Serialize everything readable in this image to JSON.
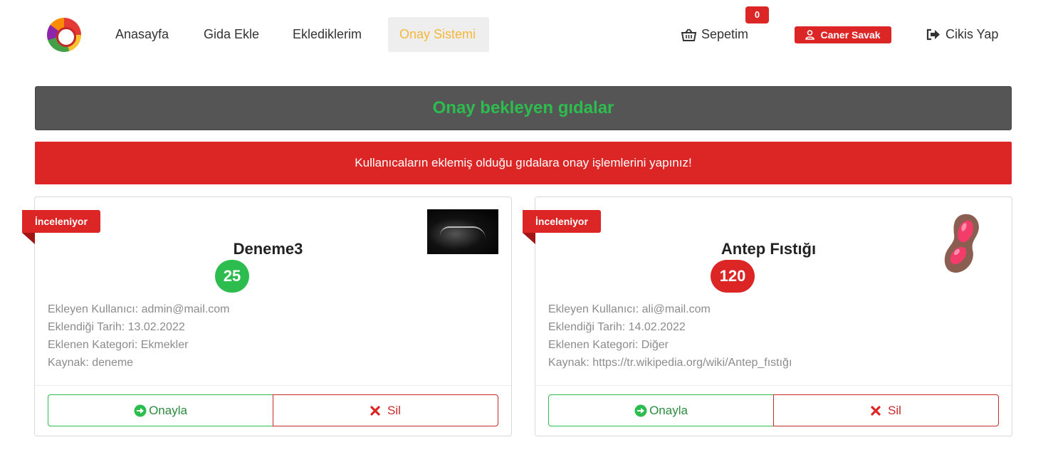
{
  "nav": {
    "links": [
      "Anasayfa",
      "Gida Ekle",
      "Eklediklerim",
      "Onay Sistemi"
    ],
    "cart_label": "Sepetim",
    "cart_count": "0",
    "user_name": "Caner Savak",
    "logout_label": "Cikis Yap"
  },
  "page": {
    "title": "Onay bekleyen gıdalar",
    "alert": "Kullanıcaların eklemiş olduğu gıdalara onay işlemlerini yapınız!"
  },
  "cards": [
    {
      "status": "İnceleniyor",
      "name": "Deneme3",
      "score": "25",
      "score_color": "#2dbd4e",
      "added_by": "Ekleyen Kullanıcı: admin@mail.com",
      "added_date": "Eklendiği Tarih: 13.02.2022",
      "category": "Eklenen Kategori: Ekmekler",
      "source": "Kaynak: deneme",
      "approve_label": "Onayla",
      "delete_label": "Sil"
    },
    {
      "status": "İnceleniyor",
      "name": "Antep Fıstığı",
      "score": "120",
      "score_color": "#dc2626",
      "added_by": "Ekleyen Kullanıcı: ali@mail.com",
      "added_date": "Eklendiği Tarih: 14.02.2022",
      "category": "Eklenen Kategori: Diğer",
      "source": "Kaynak: https://tr.wikipedia.org/wiki/Antep_fıstığı",
      "approve_label": "Onayla",
      "delete_label": "Sil"
    }
  ],
  "icons": {
    "cart": "basket-icon",
    "user": "user-icon",
    "logout": "sign-out-icon",
    "approve": "arrow-circle-right-icon",
    "delete": "times-icon"
  },
  "colors": {
    "accent_red": "#dc2626",
    "accent_green": "#2dbd4e",
    "active_nav": "#f5b73b",
    "title_bg": "#555555"
  }
}
